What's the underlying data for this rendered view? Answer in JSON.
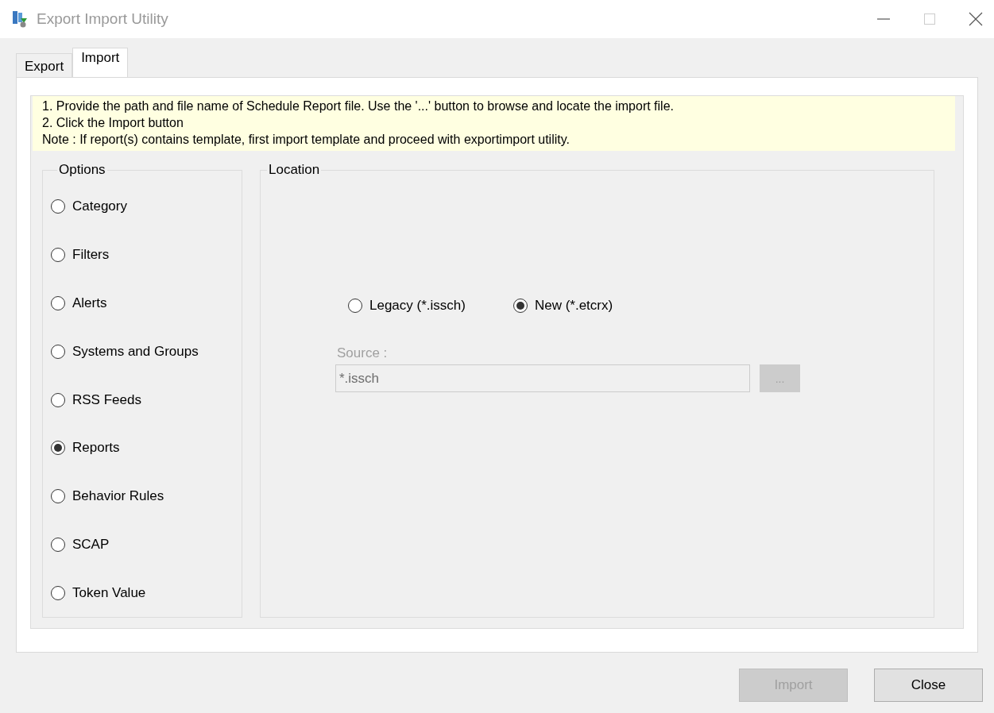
{
  "window": {
    "title": "Export Import Utility"
  },
  "tabs": [
    {
      "label": "Export",
      "selected": false
    },
    {
      "label": "Import",
      "selected": true
    }
  ],
  "instructions": [
    "1. Provide the path and file name of Schedule Report file. Use the '...' button to browse and locate the import file.",
    "2. Click the Import button",
    "Note : If report(s) contains template, first import template and proceed with exportimport utility."
  ],
  "options": {
    "title": "Options",
    "items": [
      {
        "label": "Category",
        "selected": false
      },
      {
        "label": "Filters",
        "selected": false
      },
      {
        "label": "Alerts",
        "selected": false
      },
      {
        "label": "Systems and Groups",
        "selected": false
      },
      {
        "label": "RSS Feeds",
        "selected": false
      },
      {
        "label": "Reports",
        "selected": true
      },
      {
        "label": "Behavior Rules",
        "selected": false
      },
      {
        "label": "SCAP",
        "selected": false
      },
      {
        "label": "Token Value",
        "selected": false
      }
    ]
  },
  "location": {
    "title": "Location",
    "formats": [
      {
        "label": "Legacy (*.issch)",
        "selected": false
      },
      {
        "label": "New (*.etcrx)",
        "selected": true
      }
    ],
    "source": {
      "label": "Source :",
      "value": "*.issch",
      "disabled": true
    },
    "browse": {
      "label": "...",
      "disabled": true
    }
  },
  "buttons": [
    {
      "label": "Import",
      "disabled": true
    },
    {
      "label": "Close",
      "disabled": false
    }
  ]
}
